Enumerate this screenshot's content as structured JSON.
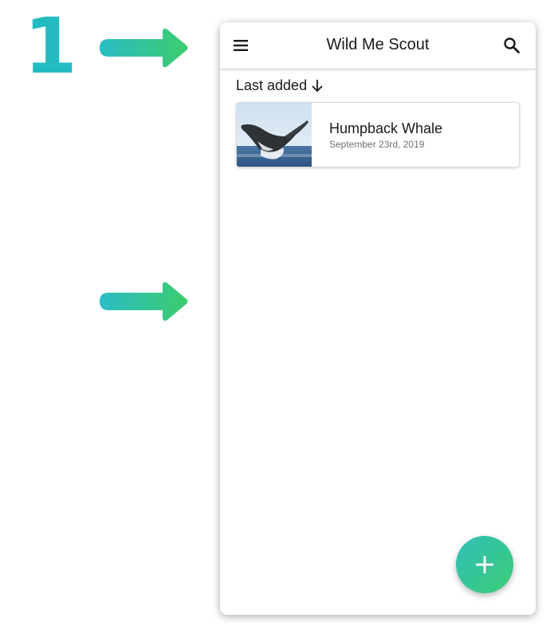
{
  "tutorial": {
    "step_number": "1"
  },
  "app_bar": {
    "menu_icon": "hamburger-menu-icon",
    "title": "Wild Me Scout",
    "search_icon": "search-icon"
  },
  "sort": {
    "label": "Last added",
    "direction_icon": "arrow-down-icon"
  },
  "sightings": [
    {
      "title": "Humpback Whale",
      "date": "September 23rd, 2019",
      "thumbnail": "breaching-whale-photo"
    }
  ],
  "fab": {
    "icon": "plus-icon"
  },
  "colors": {
    "step_number": "#22bcc0",
    "arrow_start": "#2bbcc4",
    "arrow_end": "#3ccc6e",
    "fab_start": "#2fbfb6",
    "fab_end": "#3ccc78"
  }
}
